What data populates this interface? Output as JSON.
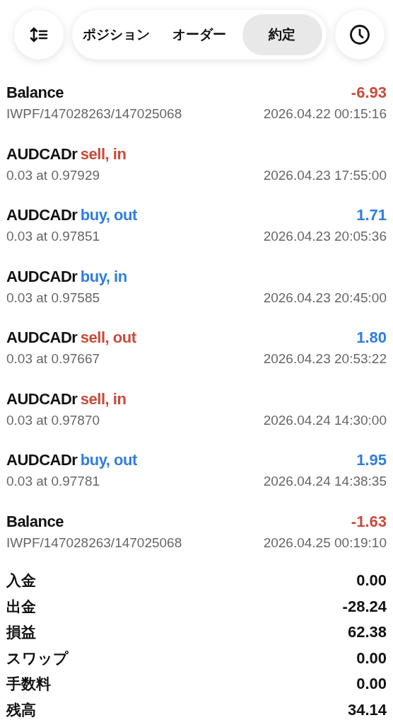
{
  "toolbar": {
    "tabs": [
      {
        "label": "ポジション",
        "selected": false
      },
      {
        "label": "オーダー",
        "selected": false
      },
      {
        "label": "約定",
        "selected": true
      }
    ]
  },
  "deals": [
    {
      "kind": "balance",
      "title": "Balance",
      "amount": {
        "text": "-6.93",
        "color": "#c84a3b"
      },
      "detail": "IWPF/147028263/147025068",
      "time": "2026.04.22 00:15:16"
    },
    {
      "kind": "trade",
      "title": "AUDCADr",
      "action": {
        "text": "sell, in",
        "color": "#c84a3b"
      },
      "detail": "0.03 at 0.97929",
      "time": "2026.04.23 17:55:00"
    },
    {
      "kind": "trade",
      "title": "AUDCADr",
      "action": {
        "text": "buy, out",
        "color": "#2f7de1"
      },
      "amount": {
        "text": "1.71",
        "color": "#2f7de1"
      },
      "detail": "0.03 at 0.97851",
      "time": "2026.04.23 20:05:36"
    },
    {
      "kind": "trade",
      "title": "AUDCADr",
      "action": {
        "text": "buy, in",
        "color": "#2f7de1"
      },
      "detail": "0.03 at 0.97585",
      "time": "2026.04.23 20:45:00"
    },
    {
      "kind": "trade",
      "title": "AUDCADr",
      "action": {
        "text": "sell, out",
        "color": "#c84a3b"
      },
      "amount": {
        "text": "1.80",
        "color": "#2f7de1"
      },
      "detail": "0.03 at 0.97667",
      "time": "2026.04.23 20:53:22"
    },
    {
      "kind": "trade",
      "title": "AUDCADr",
      "action": {
        "text": "sell, in",
        "color": "#c84a3b"
      },
      "detail": "0.03 at 0.97870",
      "time": "2026.04.24 14:30:00"
    },
    {
      "kind": "trade",
      "title": "AUDCADr",
      "action": {
        "text": "buy, out",
        "color": "#2f7de1"
      },
      "amount": {
        "text": "1.95",
        "color": "#2f7de1"
      },
      "detail": "0.03 at 0.97781",
      "time": "2026.04.24 14:38:35"
    },
    {
      "kind": "balance",
      "title": "Balance",
      "amount": {
        "text": "-1.63",
        "color": "#c84a3b"
      },
      "detail": "IWPF/147028263/147025068",
      "time": "2026.04.25 00:19:10"
    }
  ],
  "summary": [
    {
      "label": "入金",
      "value": "0.00"
    },
    {
      "label": "出金",
      "value": "-28.24"
    },
    {
      "label": "損益",
      "value": "62.38"
    },
    {
      "label": "スワップ",
      "value": "0.00"
    },
    {
      "label": "手数料",
      "value": "0.00"
    },
    {
      "label": "残高",
      "value": "34.14"
    }
  ]
}
